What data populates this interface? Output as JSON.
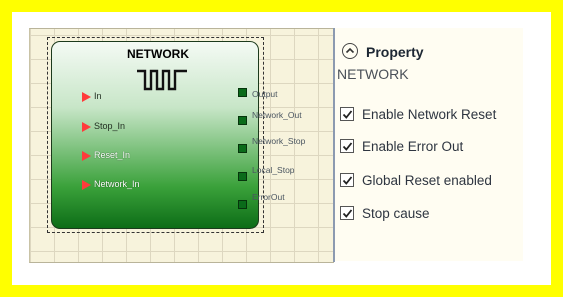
{
  "block": {
    "title": "NETWORK",
    "inputs": [
      "In",
      "Stop_In",
      "Reset_In",
      "Network_In"
    ],
    "outputs": [
      "Output",
      "Network_Out",
      "Network_Stop",
      "Local_Stop",
      "ErrorOut"
    ]
  },
  "property": {
    "title": "Property",
    "name": "NETWORK",
    "options": [
      {
        "label": "Enable Network Reset",
        "checked": true
      },
      {
        "label": "Enable Error Out",
        "checked": true
      },
      {
        "label": "Global Reset enabled",
        "checked": true
      },
      {
        "label": "Stop cause",
        "checked": true
      }
    ]
  },
  "colors": {
    "highlight": "#ffff00",
    "input_port": "#ff3b3b",
    "output_port": "#0a6b1a"
  }
}
